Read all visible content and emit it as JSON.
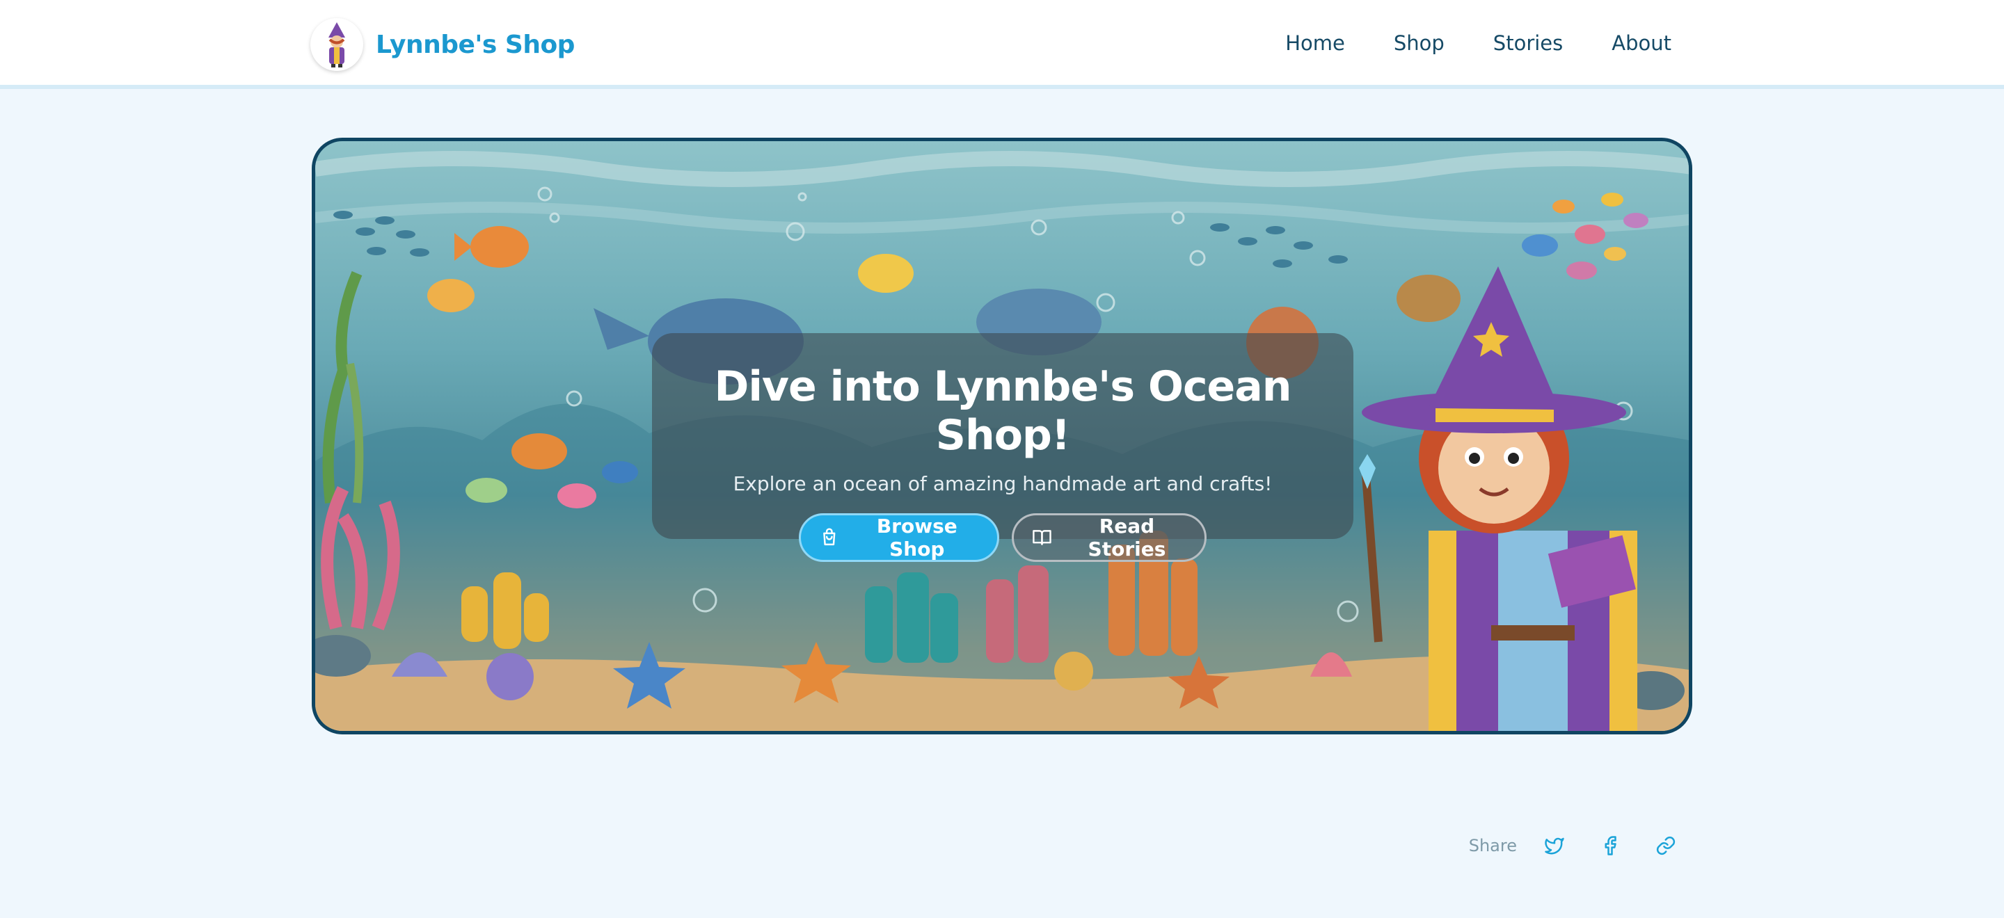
{
  "nav": {
    "brand": "Lynnbe's Shop",
    "avatar_icon": "wizard-avatar-icon",
    "links": [
      {
        "label": "Home"
      },
      {
        "label": "Shop"
      },
      {
        "label": "Stories"
      },
      {
        "label": "About"
      }
    ]
  },
  "hero": {
    "title": "Dive into Lynnbe's Ocean Shop!",
    "subtitle": "Explore an ocean of amazing handmade art and crafts!",
    "primary_button": {
      "label": "Browse Shop",
      "icon": "shopping-bag-icon"
    },
    "secondary_button": {
      "label": "Read Stories",
      "icon": "open-book-icon"
    }
  },
  "share": {
    "label": "Share",
    "icons": [
      "twitter-icon",
      "facebook-icon",
      "link-icon"
    ]
  },
  "colors": {
    "page_bg": "#eff7fd",
    "brand": "#1b98cf",
    "nav_text": "#164a66",
    "hero_border": "#0f4562",
    "primary_button": "#22aee8"
  }
}
